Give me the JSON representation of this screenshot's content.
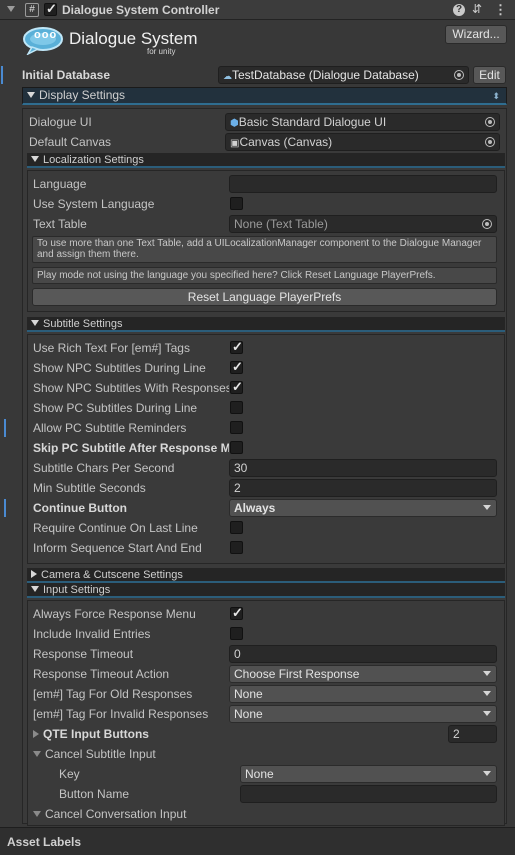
{
  "component": {
    "title": "Dialogue System Controller",
    "script_icon": "#",
    "help_icon": "?",
    "settings_icon": "⇵",
    "more_icon": "⋮"
  },
  "logo": {
    "title": "Dialogue System",
    "subtitle": "for unity",
    "bubble": "ooo"
  },
  "wizard_label": "Wizard...",
  "initial_database": {
    "label": "Initial Database",
    "value": "TestDatabase (Dialogue Database)",
    "edit_label": "Edit"
  },
  "display_settings": {
    "header": "Display Settings",
    "dialogue_ui": {
      "label": "Dialogue UI",
      "value": "Basic Standard Dialogue UI"
    },
    "default_canvas": {
      "label": "Default Canvas",
      "value": "Canvas (Canvas)"
    }
  },
  "localization": {
    "header": "Localization Settings",
    "language_label": "Language",
    "language_value": "",
    "use_system_language_label": "Use System Language",
    "use_system_language": false,
    "text_table_label": "Text Table",
    "text_table_value": "None (Text Table)",
    "help1": "To use more than one Text Table, add a UILocalizationManager component to the Dialogue Manager and assign them there.",
    "help2": "Play mode not using the language you specified here? Click Reset Language PlayerPrefs.",
    "reset_button": "Reset Language PlayerPrefs"
  },
  "subtitle": {
    "header": "Subtitle Settings",
    "rows": [
      {
        "label": "Use Rich Text For [em#] Tags",
        "checked": true
      },
      {
        "label": "Show NPC Subtitles During Line",
        "checked": true
      },
      {
        "label": "Show NPC Subtitles With Responses",
        "checked": true
      },
      {
        "label": "Show PC Subtitles During Line",
        "checked": false
      },
      {
        "label": "Allow PC Subtitle Reminders",
        "checked": false
      },
      {
        "label": "Skip PC Subtitle After Response Menu",
        "checked": false
      }
    ],
    "chars_per_second_label": "Subtitle Chars Per Second",
    "chars_per_second": "30",
    "min_seconds_label": "Min Subtitle Seconds",
    "min_seconds": "2",
    "continue_button_label": "Continue Button",
    "continue_button_value": "Always",
    "require_continue_label": "Require Continue On Last Line",
    "require_continue": false,
    "inform_sequence_label": "Inform Sequence Start And End",
    "inform_sequence": false
  },
  "camera": {
    "header": "Camera & Cutscene Settings"
  },
  "input": {
    "header": "Input Settings",
    "always_force_label": "Always Force Response Menu",
    "always_force": true,
    "include_invalid_label": "Include Invalid Entries",
    "include_invalid": false,
    "response_timeout_label": "Response Timeout",
    "response_timeout": "0",
    "timeout_action_label": "Response Timeout Action",
    "timeout_action_value": "Choose First Response",
    "old_tag_label": "[em#] Tag For Old Responses",
    "old_tag_value": "None",
    "invalid_tag_label": "[em#] Tag For Invalid Responses",
    "invalid_tag_value": "None",
    "qte_label": "QTE Input Buttons",
    "qte_value": "2",
    "cancel_subtitle_label": "Cancel Subtitle Input",
    "key_label": "Key",
    "key_value": "None",
    "button_name_label": "Button Name",
    "button_name_value": "",
    "cancel_conversation_label": "Cancel Conversation Input"
  },
  "footer": {
    "asset_labels": "Asset Labels"
  }
}
